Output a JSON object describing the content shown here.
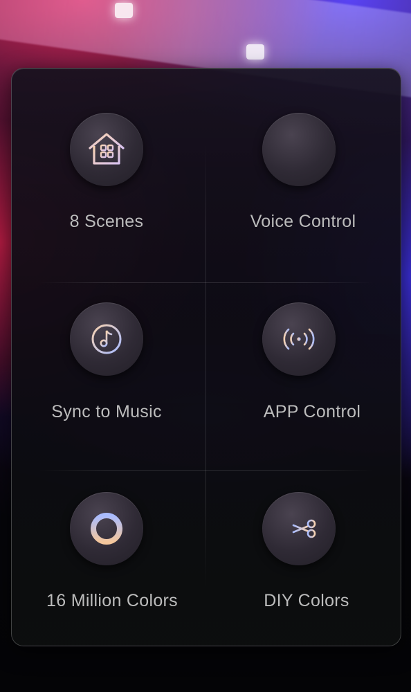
{
  "features": [
    {
      "label": "8 Scenes",
      "icon": "home-scenes-icon"
    },
    {
      "label": "Voice Control",
      "icon": "voice-waveform-icon"
    },
    {
      "label": "Sync to Music",
      "icon": "music-note-icon"
    },
    {
      "label": "APP Control",
      "icon": "wireless-signal-icon"
    },
    {
      "label": "16 Million Colors",
      "icon": "color-ring-icon"
    },
    {
      "label": "DIY Colors",
      "icon": "scissors-icon"
    }
  ],
  "colors": {
    "icon_gradient_start": "#f2c9a0",
    "icon_gradient_end": "#9fb6ff",
    "label": "#bcbcbc"
  }
}
